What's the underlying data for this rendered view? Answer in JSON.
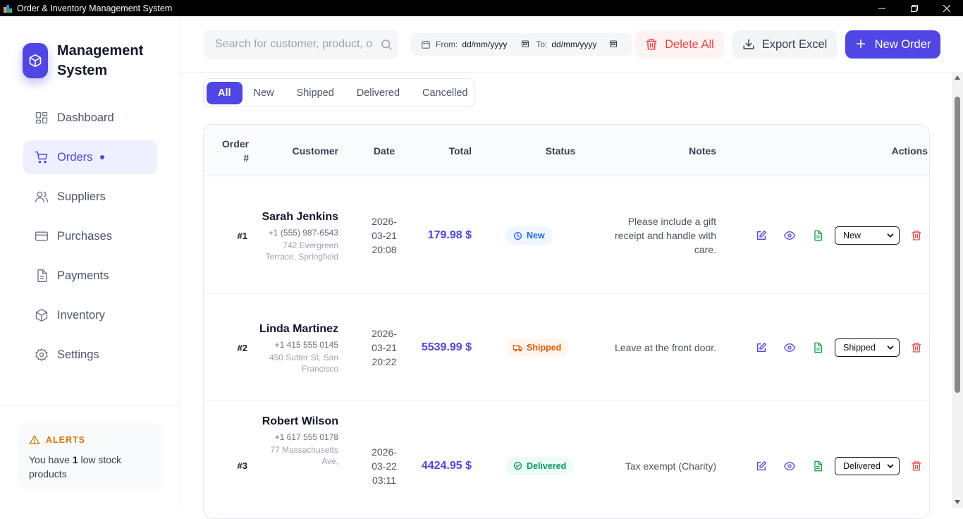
{
  "window": {
    "title": "Order & Inventory Management System"
  },
  "sidebar": {
    "brand": "Management System",
    "items": [
      {
        "label": "Dashboard",
        "icon": "dashboard-icon"
      },
      {
        "label": "Orders",
        "icon": "cart-icon",
        "active": true
      },
      {
        "label": "Suppliers",
        "icon": "users-icon"
      },
      {
        "label": "Purchases",
        "icon": "card-icon"
      },
      {
        "label": "Payments",
        "icon": "document-icon"
      },
      {
        "label": "Inventory",
        "icon": "box-icon"
      },
      {
        "label": "Settings",
        "icon": "gear-icon"
      }
    ],
    "alerts": {
      "title": "ALERTS",
      "text_before": "You have ",
      "count": "1",
      "text_after": " low stock products"
    }
  },
  "toolbar": {
    "search_placeholder": "Search for customer, product, o",
    "date_from_label": "From:",
    "date_from_value": "dd/mm/yyyy",
    "date_to_label": "To:",
    "date_to_value": "dd/mm/yyyy",
    "delete_all_label": "Delete All",
    "export_label": "Export Excel",
    "new_order_label": "New Order"
  },
  "tabs": [
    "All",
    "New",
    "Shipped",
    "Delivered",
    "Cancelled"
  ],
  "table": {
    "headers": {
      "order": "Order #",
      "customer": "Customer",
      "date": "Date",
      "total": "Total",
      "status": "Status",
      "notes": "Notes",
      "actions": "Actions"
    },
    "rows": [
      {
        "order": "#1",
        "name": "Sarah Jenkins",
        "phone": "+1 (555) 987-6543",
        "address": "742 Evergreen Terrace, Springfield",
        "date": "2026-03-21 20:08",
        "total": "179.98 $",
        "status": "New",
        "notes": "Please include a gift receipt and handle with care.",
        "select": "New"
      },
      {
        "order": "#2",
        "name": "Linda Martinez",
        "phone": "+1 415 555 0145",
        "address": "450 Sutter St, San Francisco",
        "date": "2026-03-21 20:22",
        "total": "5539.99 $",
        "status": "Shipped",
        "notes": "Leave at the front door.",
        "select": "Shipped"
      },
      {
        "order": "#3",
        "name": "Robert Wilson",
        "phone": "+1 617 555 0178",
        "address": "77 Massachusetts Ave,",
        "date": "2026-03-22 03:11",
        "total": "4424.95 $",
        "status": "Delivered",
        "notes": "Tax exempt (Charity)",
        "select": "Delivered"
      }
    ]
  },
  "colors": {
    "accent": "#4f46e5",
    "danger": "#ef4444",
    "success": "#16a34a",
    "warning": "#ea580c"
  }
}
